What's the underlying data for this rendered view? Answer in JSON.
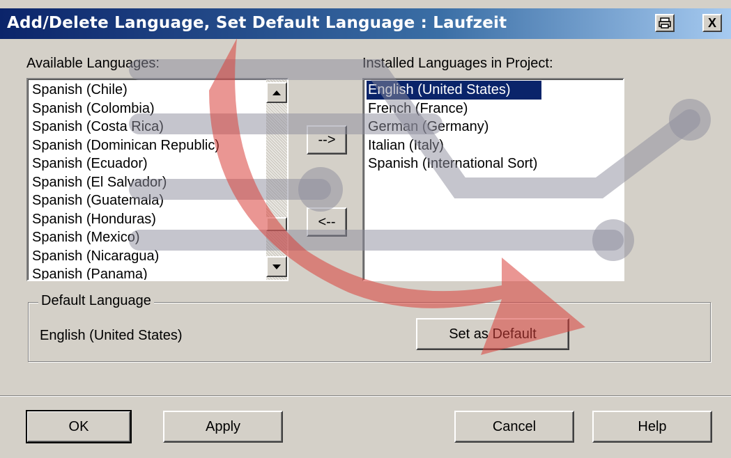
{
  "window": {
    "title": "Add/Delete Language, Set Default Language : Laufzeit",
    "print_icon": "printer-icon",
    "close_label": "X"
  },
  "available": {
    "label": "Available Languages:",
    "items": [
      "Spanish (Chile)",
      "Spanish (Colombia)",
      "Spanish (Costa Rica)",
      "Spanish (Dominican Republic)",
      "Spanish (Ecuador)",
      "Spanish (El Salvador)",
      "Spanish (Guatemala)",
      "Spanish (Honduras)",
      "Spanish (Mexico)",
      "Spanish (Nicaragua)",
      "Spanish (Panama)"
    ]
  },
  "transfer": {
    "add_label": "-->",
    "remove_label": "<--"
  },
  "installed": {
    "label": "Installed Languages in Project:",
    "items": [
      "English (United States)",
      "French (France)",
      "German (Germany)",
      "Italian (Italy)",
      "Spanish (International Sort)"
    ],
    "selected": "English (United States)"
  },
  "default_group": {
    "legend": "Default Language",
    "value": "English (United States)",
    "set_default_label": "Set as Default"
  },
  "buttons": {
    "ok": "OK",
    "apply": "Apply",
    "cancel": "Cancel",
    "help": "Help"
  },
  "colors": {
    "titlebar_start": "#0b246a",
    "selection": "#0a246a",
    "face": "#d4d0c8",
    "watermark_red": "#d9403a",
    "watermark_gray": "#9a9aa8"
  }
}
